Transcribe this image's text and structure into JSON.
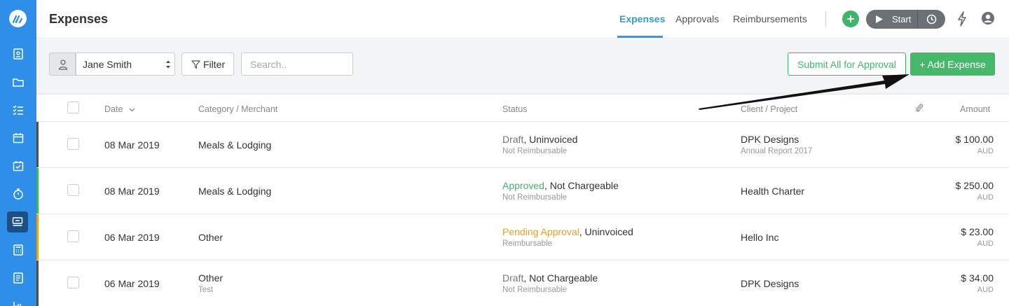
{
  "header": {
    "title": "Expenses",
    "tabs": [
      {
        "label": "Expenses",
        "active": true
      },
      {
        "label": "Approvals",
        "active": false
      },
      {
        "label": "Reimbursements",
        "active": false
      }
    ],
    "timer": {
      "start_label": "Start"
    }
  },
  "toolbar": {
    "user_select": "Jane Smith",
    "filter_label": "Filter",
    "search_placeholder": "Search..",
    "submit_label": "Submit All for Approval",
    "add_label": "+ Add Expense"
  },
  "table": {
    "columns": {
      "date": "Date",
      "category": "Category / Merchant",
      "status": "Status",
      "client": "Client / Project",
      "amount": "Amount"
    },
    "rows": [
      {
        "bar_color": "#4a4f55",
        "date": "08 Mar 2019",
        "category": "Meals & Lodging",
        "category_sub": "",
        "status_primary": "Draft",
        "status_primary_style": "muted",
        "status_secondary": ", Uninvoiced",
        "status_sub": "Not Reimbursable",
        "client": "DPK Designs",
        "project": "Annual Report 2017",
        "amount": "$ 100.00",
        "currency": "AUD"
      },
      {
        "bar_color": "#3fb56a",
        "date": "08 Mar 2019",
        "category": "Meals & Lodging",
        "category_sub": "",
        "status_primary": "Approved",
        "status_primary_style": "green",
        "status_secondary": ", Not Chargeable",
        "status_sub": "Not Reimbursable",
        "client": "Health Charter",
        "project": "",
        "amount": "$ 250.00",
        "currency": "AUD"
      },
      {
        "bar_color": "#e8a020",
        "date": "06 Mar 2019",
        "category": "Other",
        "category_sub": "",
        "status_primary": "Pending Approval",
        "status_primary_style": "orange",
        "status_secondary": ", Uninvoiced",
        "status_sub": "Reimbursable",
        "client": "Hello Inc",
        "project": "",
        "amount": "$ 23.00",
        "currency": "AUD"
      },
      {
        "bar_color": "#4a4f55",
        "date": "06 Mar 2019",
        "category": "Other",
        "category_sub": "Test",
        "status_primary": "Draft",
        "status_primary_style": "muted",
        "status_secondary": ", Not Chargeable",
        "status_sub": "Not Reimbursable",
        "client": "DPK Designs",
        "project": "",
        "amount": "$ 34.00",
        "currency": "AUD"
      }
    ]
  },
  "colors": {
    "sidebar": "#2f8ee8",
    "accent": "#2e9fd4",
    "success": "#3fb56a",
    "warning": "#e8a020"
  },
  "icons": [
    "logo-icon",
    "timesheet-icon",
    "folder-icon",
    "tasks-icon",
    "calendar-icon",
    "checklist-icon",
    "stopwatch-icon",
    "expenses-icon",
    "calculator-icon",
    "invoice-icon",
    "reports-icon",
    "plus-icon",
    "play-icon",
    "clock-icon",
    "bolt-icon",
    "user-icon",
    "filter-icon",
    "attachment-icon",
    "sort-down-icon"
  ]
}
